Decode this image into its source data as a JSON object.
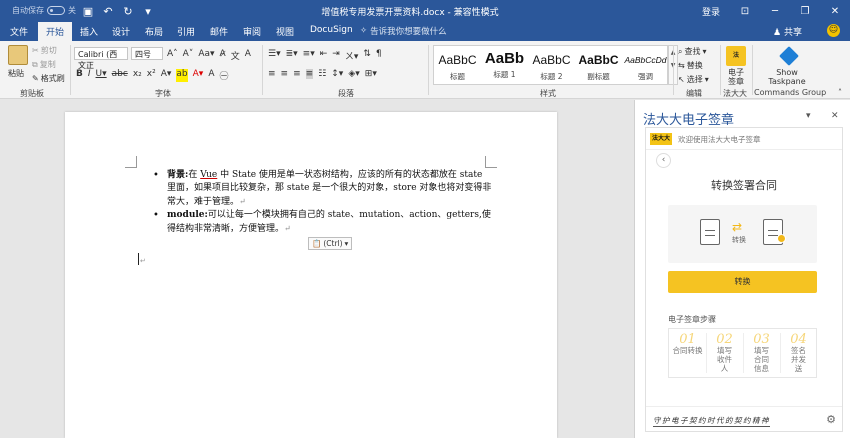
{
  "titlebar": {
    "autosave_label": "自动保存",
    "autosave_state": "关",
    "title": "增值税专用发票开票资料.docx - 兼容性模式",
    "login": "登录",
    "icons": [
      "save-icon",
      "undo-icon",
      "redo-icon",
      "customize-qat-icon"
    ]
  },
  "tabs": {
    "items": [
      "文件",
      "开始",
      "插入",
      "设计",
      "布局",
      "引用",
      "邮件",
      "审阅",
      "视图",
      "DocuSign"
    ],
    "active": "开始",
    "tellme": "告诉我你想要做什么",
    "share": "共享"
  },
  "ribbon": {
    "clipboard": {
      "paste": "粘贴",
      "cut": "剪切",
      "copy": "复制",
      "format_painter": "格式刷",
      "label": "剪贴板"
    },
    "font": {
      "name": "Calibri (西文正",
      "size": "四号",
      "label": "字体"
    },
    "paragraph": {
      "label": "段落"
    },
    "styles": {
      "label": "样式",
      "items": [
        {
          "sample": "AaBbC",
          "name": "标题"
        },
        {
          "sample": "AaBb",
          "name": "标题 1"
        },
        {
          "sample": "AaBbC",
          "name": "标题 2"
        },
        {
          "sample": "AaBbC",
          "name": "副标题"
        },
        {
          "sample": "AaBbCcDd",
          "name": "强调"
        }
      ]
    },
    "editing": {
      "find": "查找",
      "replace": "替换",
      "select": "选择",
      "label": "编辑"
    },
    "fadada": {
      "button": "电子签章",
      "label": "法大大"
    },
    "commands": {
      "button": "Show Taskpane",
      "label": "Commands Group"
    }
  },
  "document": {
    "bullet1": {
      "label": "背景:",
      "t1": "在 ",
      "vue": "Vue",
      "t2": " 中 State 使用是单一状态树结构，应该的所有的状态都放在 state 里面，如果项目比较复杂，那 state 是一个很大的对象，store 对象也将对变得非常大，难于管理。",
      "mark": "↵"
    },
    "bullet2": {
      "label": "module:",
      "text": "可以让每一个模块拥有自己的 state、mutation、action、getters,使得结构非常清晰，方便管理。",
      "mark": "↵"
    },
    "paste_options": "(Ctrl)",
    "end_mark": "↵"
  },
  "pane": {
    "title": "法大大电子签章",
    "logo": "法大大",
    "welcome": "欢迎使用法大大电子签章",
    "section_title": "转换签署合同",
    "convert_label": "转换",
    "button": "转换",
    "steps_title": "电子签章步骤",
    "steps": [
      {
        "num": "01",
        "text": "合同转换"
      },
      {
        "num": "02",
        "text": "填写收件人"
      },
      {
        "num": "03",
        "text": "填写合同信息"
      },
      {
        "num": "04",
        "text": "签名并发送"
      }
    ],
    "slogan": "守护电子契约时代的契约精神"
  }
}
